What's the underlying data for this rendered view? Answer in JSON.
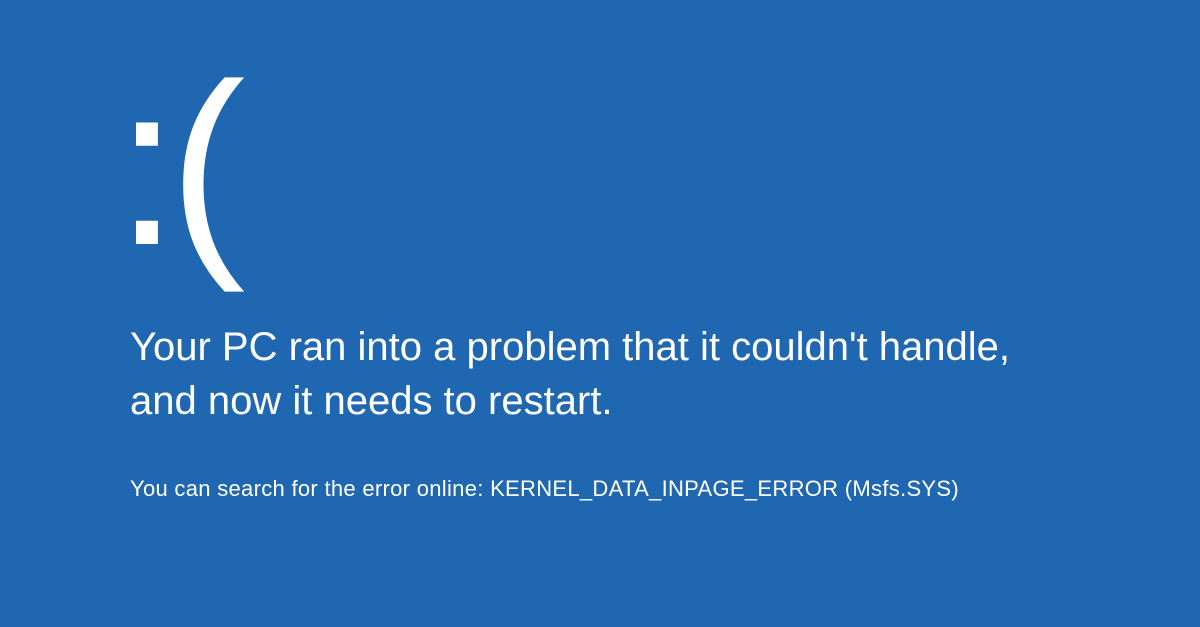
{
  "bsod": {
    "sad_face": ":(",
    "message": "Your PC ran into a problem that it couldn't handle, and now it needs to restart.",
    "error_prefix": "You can search for the error online: ",
    "error_code": "KERNEL_DATA_INPAGE_ERROR (Msfs.SYS)"
  },
  "colors": {
    "background": "#2067b2",
    "text": "#ffffff"
  }
}
